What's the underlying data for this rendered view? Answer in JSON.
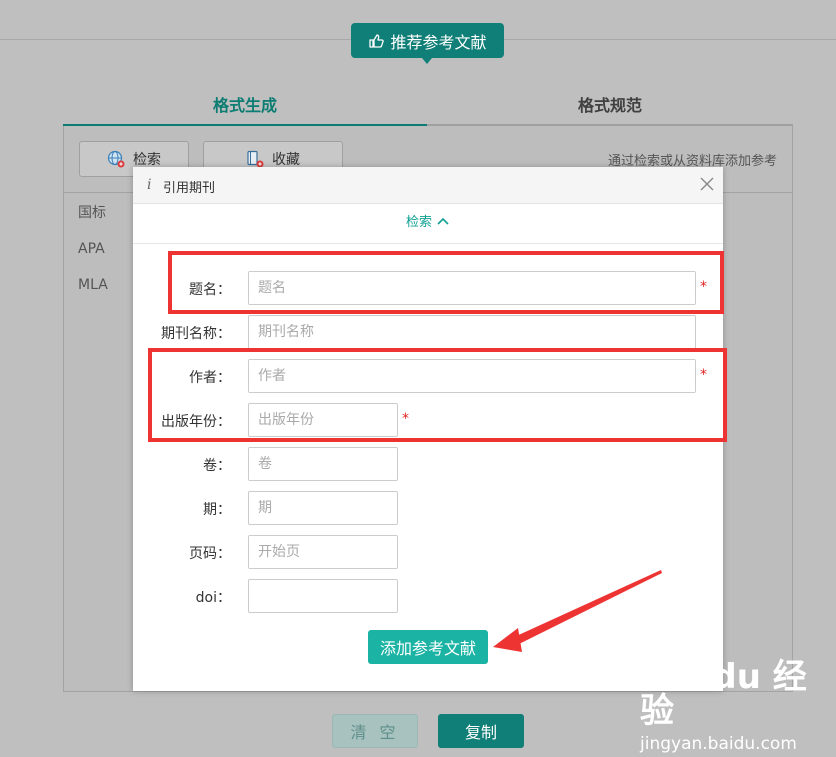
{
  "header": {
    "recommend_label": "推荐参考文献"
  },
  "tabs": [
    {
      "label": "格式生成",
      "active": true
    },
    {
      "label": "格式规范",
      "active": false
    }
  ],
  "toolbar": {
    "search_label": "检索",
    "favorites_label": "收藏",
    "hint": "通过检索或从资料库添加参考"
  },
  "styles_list": [
    "国标",
    "APA",
    "MLA"
  ],
  "footer": {
    "clear_label": "清 空",
    "copy_label": "复制"
  },
  "dialog": {
    "title": "引用期刊",
    "search_toggle": "检索",
    "fields": {
      "title": {
        "label": "题名：",
        "placeholder": "题名",
        "value": ""
      },
      "journal": {
        "label": "期刊名称：",
        "placeholder": "期刊名称",
        "value": ""
      },
      "author": {
        "label": "作者：",
        "placeholder": "作者",
        "value": ""
      },
      "year": {
        "label": "出版年份：",
        "placeholder": "出版年份",
        "value": ""
      },
      "volume": {
        "label": "卷：",
        "placeholder": "卷",
        "value": ""
      },
      "issue": {
        "label": "期：",
        "placeholder": "期",
        "value": ""
      },
      "pages": {
        "label": "页码：",
        "placeholder": "开始页",
        "value": ""
      },
      "doi": {
        "label": "doi：",
        "placeholder": "",
        "value": ""
      }
    },
    "required_mark": "*",
    "add_label": "添加参考文献"
  },
  "watermark": {
    "brand": "Bai du 经验",
    "url": "jingyan.baidu.com"
  },
  "colors": {
    "primary": "#107f77",
    "accent": "#1ab3a4",
    "highlight": "#ee3333",
    "required": "#e02020"
  },
  "icons": [
    "thumbs-up-icon",
    "globe-search-icon",
    "book-add-icon",
    "info-icon",
    "close-icon",
    "chevron-up-icon"
  ]
}
